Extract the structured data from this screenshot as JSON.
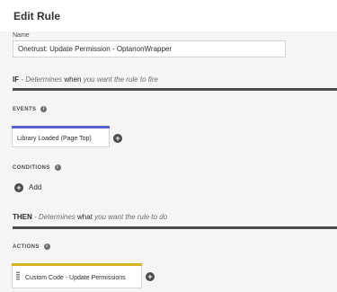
{
  "header": {
    "title": "Edit Rule"
  },
  "name_field": {
    "label": "Name",
    "value": "Onetrust: Update Permission - OptanonWrapper"
  },
  "if_section": {
    "key": "IF",
    "desc_prefix": "- Determines ",
    "desc_bold": "when",
    "desc_suffix": " you want the rule to fire"
  },
  "events": {
    "label": "EVENTS",
    "card": {
      "label": "Library Loaded (Page Top)",
      "accent_color": "#5b5fd1"
    }
  },
  "conditions": {
    "label": "CONDITIONS",
    "add_label": "Add"
  },
  "then_section": {
    "key": "THEN",
    "desc_prefix": "- Determines ",
    "desc_bold": "what",
    "desc_suffix": " you want the rule to do"
  },
  "actions": {
    "label": "ACTIONS",
    "card": {
      "label": "Custom Code - Update Permissions",
      "accent_color": "#d4b51f"
    }
  },
  "icons": {
    "info": "info-icon",
    "add": "plus-circle-icon",
    "grip": "drag-handle-icon"
  }
}
